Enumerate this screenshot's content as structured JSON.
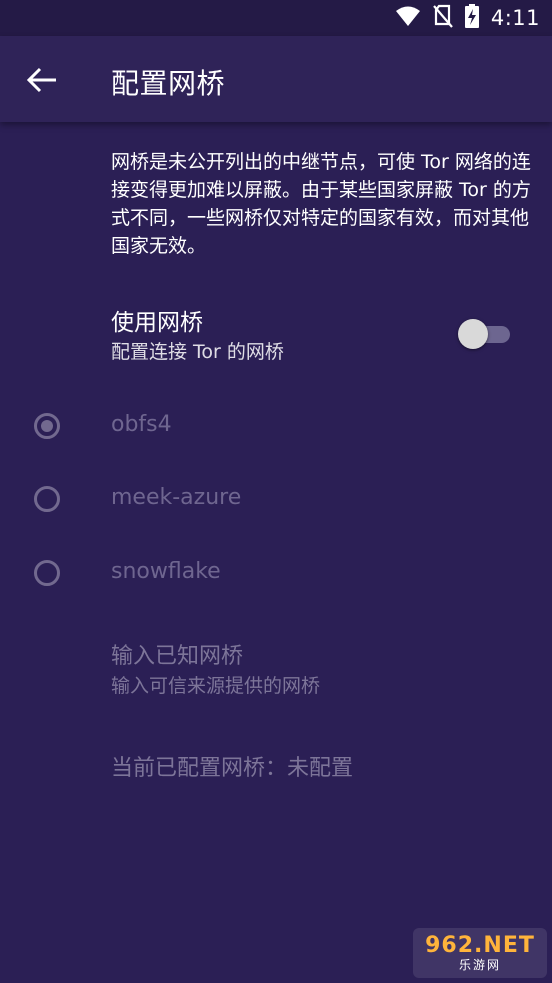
{
  "status_bar": {
    "time": "4:11",
    "icons": [
      "wifi-icon",
      "no-sim-icon",
      "battery-charging-icon"
    ]
  },
  "app_bar": {
    "title": "配置网桥",
    "back_icon": "arrow-back-icon"
  },
  "description": "网桥是未公开列出的中继节点，可使 Tor 网络的连接变得更加难以屏蔽。由于某些国家屏蔽 Tor 的方式不同，一些网桥仅对特定的国家有效，而对其他国家无效。",
  "use_bridges": {
    "title": "使用网桥",
    "subtitle": "配置连接 Tor 的网桥",
    "enabled": false
  },
  "transports": [
    {
      "label": "obfs4",
      "checked": true
    },
    {
      "label": "meek-azure",
      "checked": false
    },
    {
      "label": "snowflake",
      "checked": false
    }
  ],
  "known_bridges": {
    "title": "输入已知网桥",
    "subtitle": "输入可信来源提供的网桥"
  },
  "current_bridges": "当前已配置网桥：未配置",
  "watermark": {
    "main": "962.NET",
    "sub": "乐游网"
  },
  "colors": {
    "background": "#2b1f55",
    "app_bar": "#2f2358",
    "disabled_text": "#6f6690"
  }
}
